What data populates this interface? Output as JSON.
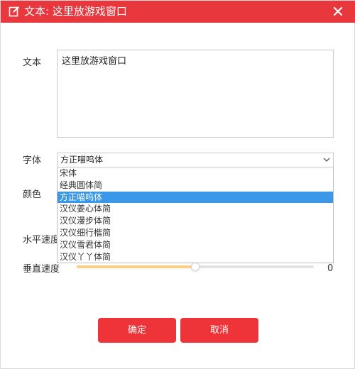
{
  "titlebar": {
    "title": "文本: 这里放游戏窗口",
    "title_icon": "edit-icon",
    "close_icon": "close-icon",
    "accent_color": "#e8383d"
  },
  "form": {
    "text_label": "文本",
    "text_value": "这里放游戏窗口",
    "font_label": "字体",
    "font_selected": "方正喵呜体",
    "font_options": [
      "宋体",
      "经典圆体简",
      "方正喵呜体",
      "汉仪姜心体简",
      "汉仪漫步体简",
      "汉仪细行楷简",
      "汉仪雪君体简",
      "汉仪丫丫体简"
    ],
    "font_highlighted_index": 2,
    "color_label": "颜色",
    "h_speed_label": "水平速度",
    "v_speed_label": "垂直速度",
    "v_speed_value": "0",
    "v_speed_fill_fraction": 0.5
  },
  "buttons": {
    "ok_label": "确定",
    "cancel_label": "取消"
  }
}
